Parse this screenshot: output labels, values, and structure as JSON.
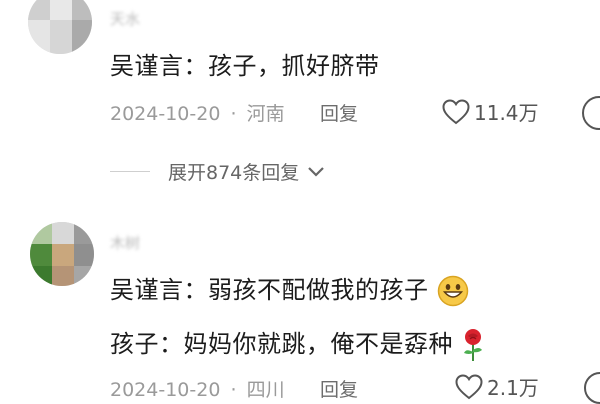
{
  "comments": [
    {
      "username": "天水",
      "text": "吴谨言：孩子，抓好脐带",
      "date": "2024-10-20",
      "location": "河南",
      "reply_label": "回复",
      "likes": "11.4万"
    },
    {
      "username": "木树",
      "line1": "吴谨言：弱孩不配做我的孩子",
      "line1_emoji": "grinning-face-emoji",
      "line2": "孩子：妈妈你就跳，俺不是孬种",
      "line2_emoji": "rose-emoji",
      "date": "2024-10-20",
      "location": "四川",
      "reply_label": "回复",
      "likes": "2.1万"
    }
  ],
  "expand_replies": "展开874条回复",
  "separator": "·",
  "icons": {
    "like": "heart-outline-icon",
    "expand": "chevron-down-icon"
  },
  "colors": {
    "text": "#1c1c1c",
    "meta": "#9a9a9a",
    "reply": "#6d6d6d"
  }
}
